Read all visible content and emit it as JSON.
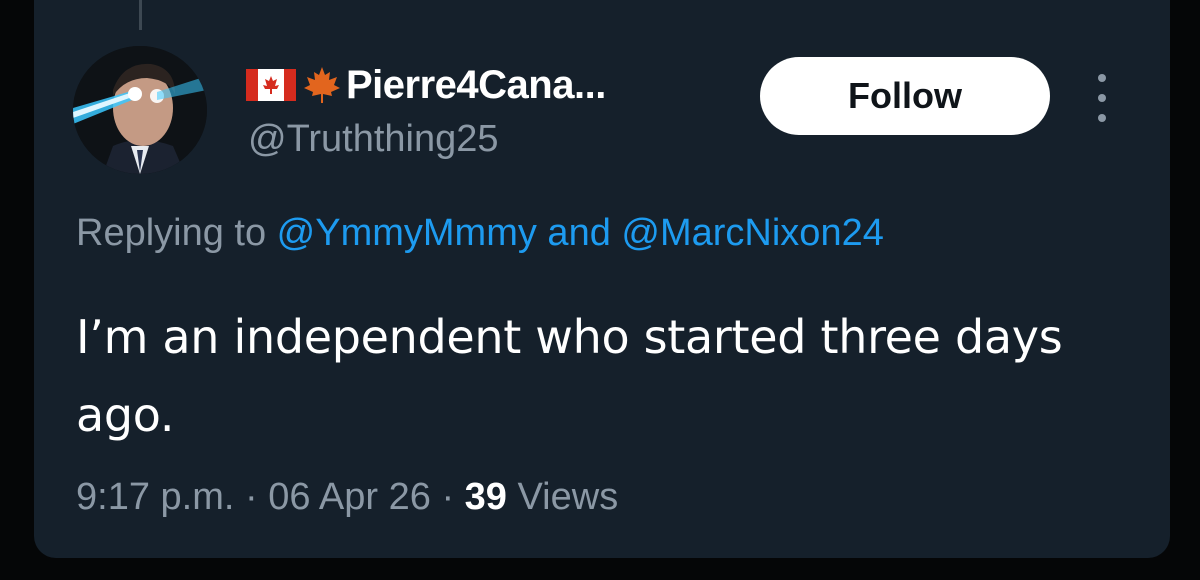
{
  "author": {
    "display_name": "Pierre4Cana...",
    "handle": "@Truththing25",
    "flag_emoji": "canada-flag-icon",
    "leaf_emoji": "maple-leaf-icon"
  },
  "follow_button": {
    "label": "Follow"
  },
  "more_menu": {
    "icon": "more-vertical-icon"
  },
  "reply": {
    "prefix": "Replying to ",
    "mention_1": "@YmmyMmmy",
    "conjunction": " and ",
    "mention_2": "@MarcNixon24"
  },
  "tweet": {
    "text": "I’m an independent who started three days ago."
  },
  "meta": {
    "time": "9:17 p.m.",
    "sep1": " · ",
    "date": "06 Apr 26",
    "sep2": " · ",
    "views_count": "39",
    "views_label": " Views"
  },
  "colors": {
    "card_bg": "#15202b",
    "muted": "#8b98a5",
    "accent": "#1d9bf0",
    "text": "#ffffff"
  }
}
